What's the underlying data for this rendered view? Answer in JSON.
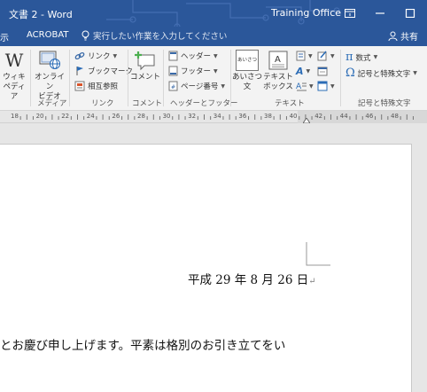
{
  "window": {
    "title": "文書 2 - Word",
    "user": "Training Office"
  },
  "tabs": {
    "partial": "示",
    "acrobat": "ACROBAT",
    "tell_me_placeholder": "実行したい作業を入力してください",
    "share": "共有"
  },
  "ribbon": {
    "groups": {
      "media": "メディア",
      "links": "リンク",
      "comments": "コメント",
      "header_footer": "ヘッダーとフッター",
      "text": "テキスト",
      "symbols": "記号と特殊文字"
    },
    "buttons": {
      "wiki_line1": "ウィキ",
      "wiki_line2": "ペディア",
      "online_video_line1": "オンライン",
      "online_video_line2": "ビデオ",
      "link": "リンク",
      "bookmark": "ブックマーク",
      "cross_ref": "相互参照",
      "comment": "コメント",
      "header": "ヘッダー",
      "footer": "フッター",
      "page_number": "ページ番号",
      "greeting_line1": "あいさつ",
      "greeting_line2": "文",
      "textbox_line1": "テキスト",
      "textbox_line2": "ボックス",
      "equation": "数式",
      "symbol": "記号と特殊文字",
      "greeting_icon_text": "あいさつ"
    }
  },
  "ruler": {
    "ticks": [
      "18",
      "20",
      "22",
      "24",
      "26",
      "28",
      "30",
      "32",
      "34",
      "36",
      "38",
      "40",
      "42",
      "44",
      "46",
      "48"
    ]
  },
  "document": {
    "date": "平成 29 年 8 月 26 日",
    "body_line": "とお慶び申し上げます。平素は格別のお引き立てをい"
  }
}
